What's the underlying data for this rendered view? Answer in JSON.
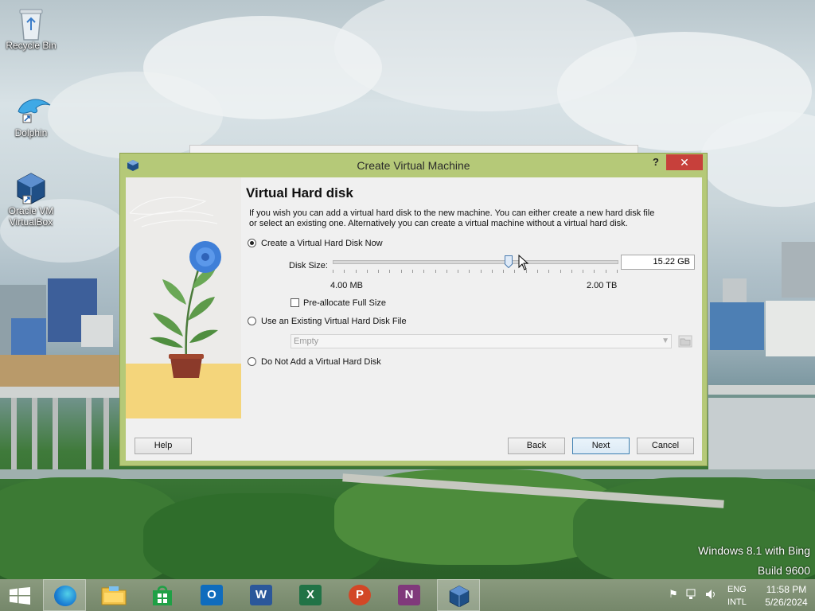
{
  "desktop": {
    "icons": [
      {
        "label": "Recycle Bin",
        "icon": "recycle-bin-icon"
      },
      {
        "label": "Dolphin",
        "icon": "dolphin-icon"
      },
      {
        "label": "Oracle VM VirtualBox",
        "icon": "virtualbox-icon"
      }
    ],
    "watermark": {
      "line1": "Windows 8.1 with Bing",
      "line2": "Build 9600"
    }
  },
  "dialog": {
    "title": "Create Virtual Machine",
    "help_glyph": "?",
    "close_glyph": "✕",
    "page_title": "Virtual Hard disk",
    "description": "If you wish you can add a virtual hard disk to the new machine. You can either create a new hard disk file or select an existing one. Alternatively you can create a virtual machine without a virtual hard disk.",
    "options": {
      "create_new": {
        "label": "Create a Virtual Hard Disk Now",
        "selected": true
      },
      "use_existing": {
        "label": "Use an Existing Virtual Hard Disk File",
        "selected": false
      },
      "no_disk": {
        "label": "Do Not Add a Virtual Hard Disk",
        "selected": false
      }
    },
    "disk_size": {
      "label": "Disk Size:",
      "value": "15.22 GB",
      "min_label": "4.00 MB",
      "max_label": "2.00 TB",
      "slider_fraction": 0.62
    },
    "preallocate": {
      "label": "Pre-allocate Full Size",
      "checked": false
    },
    "existing_disk": {
      "value": "Empty",
      "enabled": false
    },
    "buttons": {
      "help": "Help",
      "back": "Back",
      "next": "Next",
      "cancel": "Cancel"
    }
  },
  "taskbar": {
    "apps": [
      {
        "name": "start",
        "icon": "windows-start-icon"
      },
      {
        "name": "Edge",
        "icon": "edge-icon",
        "glyph": "e",
        "color": "#1d8ad6"
      },
      {
        "name": "File Explorer",
        "icon": "file-explorer-icon",
        "color": "#e8b737"
      },
      {
        "name": "Store",
        "icon": "store-icon",
        "color": "#1fa045"
      },
      {
        "name": "Outlook",
        "icon": "outlook-icon",
        "glyph": "O",
        "color": "#0f6cbd"
      },
      {
        "name": "Word",
        "icon": "word-icon",
        "glyph": "W",
        "color": "#2b579a"
      },
      {
        "name": "Excel",
        "icon": "excel-icon",
        "glyph": "X",
        "color": "#217346"
      },
      {
        "name": "PowerPoint",
        "icon": "powerpoint-icon",
        "glyph": "P",
        "color": "#d24726"
      },
      {
        "name": "OneNote",
        "icon": "onenote-icon",
        "glyph": "N",
        "color": "#80397b"
      },
      {
        "name": "VirtualBox",
        "icon": "virtualbox-icon",
        "color": "#183a61"
      }
    ],
    "tray": {
      "lang_line1": "ENG",
      "lang_line2": "INTL",
      "time": "11:58 PM",
      "date": "5/26/2024"
    }
  }
}
